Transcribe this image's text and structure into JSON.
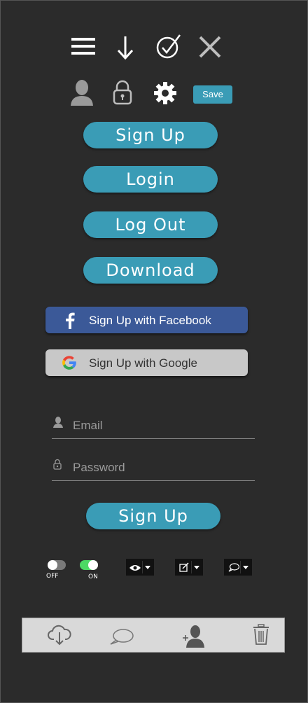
{
  "icons": {
    "menu": "hamburger-icon",
    "download": "arrow-down-icon",
    "check": "check-circle-icon",
    "close": "close-icon",
    "user": "user-icon",
    "lock": "lock-icon",
    "settings": "gear-icon"
  },
  "toolbar": {
    "save_label": "Save"
  },
  "buttons": {
    "signup": "Sign Up",
    "login": "Login",
    "logout": "Log Out",
    "download": "Download"
  },
  "social": {
    "facebook": "Sign Up with Facebook",
    "google": "Sign Up with Google"
  },
  "form": {
    "email_placeholder": "Email",
    "password_placeholder": "Password",
    "submit": "Sign Up"
  },
  "toggles": {
    "off_label": "OFF",
    "on_label": "ON"
  },
  "colors": {
    "background": "#2b2b2b",
    "accent": "#3a9cb6",
    "facebook": "#3b5998",
    "google_bg": "#c8c8c8",
    "toggle_on": "#4cd964"
  }
}
